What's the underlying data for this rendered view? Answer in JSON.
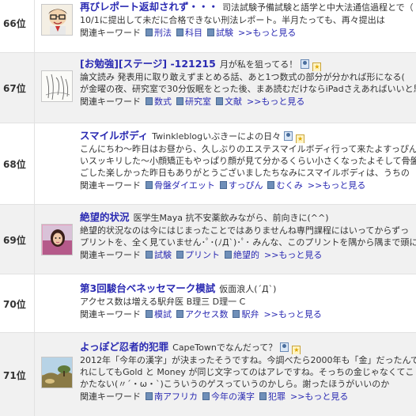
{
  "keyword_label": "関連キーワード",
  "more_label": ">>もっと見る",
  "entries": [
    {
      "rank": "66位",
      "title": "再びレポート返却されず・・・",
      "author": "司法試験予備試験と語学と中大法通信過程とで（",
      "description": [
        "10/1に提出して未だに合格できない刑法レポート。半月たっても、再々提出は"
      ],
      "keywords": [
        "刑法",
        "科目",
        "試験"
      ],
      "thumb": "cartoon-avatar",
      "show_icons": false
    },
    {
      "rank": "67位",
      "title": "[お勉強][ステージ] -121215",
      "author": "月が私を狙ってる！",
      "description": [
        "論文読み 発表用に取り敢えずまとめる話、あと1つ数式の部分が分かれば形になる(",
        "が金曜の夜、研究室で30分仮眠をとった後、まあ読むだけならiPadさえあればいいと思"
      ],
      "keywords": [
        "数式",
        "研究室",
        "文献"
      ],
      "thumb": "sketch",
      "show_icons": true
    },
    {
      "rank": "68位",
      "title": "スマイルボディ",
      "author": "Twinkleblogいぶきーによの日々",
      "description": [
        "こんにちわ〜昨日はお昼から、久しぶりのエステスマイルボディ行って来たよすっぴん",
        "いスッキリした〜小顔矯正もやっぱり顔が見て分かるくらい小さくなったよそして骨盤で",
        "ごした楽しかった昨日もありがとうございましたちなみにスマイルボディは、うちの"
      ],
      "keywords": [
        "骨盤ダイエット",
        "すっぴん",
        "むくみ"
      ],
      "thumb": "none",
      "show_icons": true
    },
    {
      "rank": "69位",
      "title": "絶望的状況",
      "author": "医学生Maya 抗不安薬飲みながら、前向きに(^^)",
      "description": [
        "絶望的状況なのは今にはじまったことではありませんね専門課程にはいってからずっ",
        "プリントを、全く見ていません･ﾟ･(ﾉД`)･ﾟ･ みんな、このプリントを隅から隅まで頭にい"
      ],
      "keywords": [
        "試験",
        "プリント",
        "絶望的"
      ],
      "thumb": "photo-person",
      "show_icons": true
    },
    {
      "rank": "70位",
      "title": "第3回駿台ベネッセマーク模試",
      "author": "仮面浪人(´Д`)",
      "description": [
        "アクセス数は増える駅弁医 B理三 D理一 C"
      ],
      "keywords": [
        "模試",
        "アクセス数",
        "駅弁"
      ],
      "thumb": "none",
      "show_icons": false
    },
    {
      "rank": "71位",
      "title": "よっぽど忍者的犯罪",
      "author": "CapeTownでなんだって？",
      "description": [
        "2012年「今年の漢字」が決まったそうですね。今調べたら2000年も「金」だったんです",
        "れにしてもGold と Money が同じ文字ってのはアレですね。そっちの金じゃなくてこ",
        "かたない(〃´・ω・`)こういうのゲスっていうのかしら。謝ったほうがいいのか"
      ],
      "keywords": [
        "南アフリカ",
        "今年の漢字",
        "犯罪"
      ],
      "thumb": "photo-landscape",
      "show_icons": true
    }
  ],
  "colors": {
    "title_link": "#2a2ab2",
    "row_alt_bg": "#f1f1f1",
    "border": "#e2e2e2"
  }
}
